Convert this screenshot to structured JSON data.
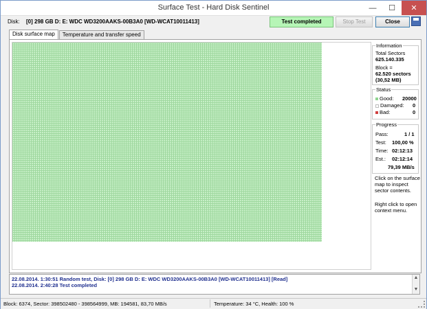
{
  "window": {
    "title": "Surface Test - Hard Disk Sentinel",
    "minimize": "—",
    "maximize": "☐",
    "close": "✕"
  },
  "disk": {
    "label": "Disk:",
    "value": "[0] 298 GB D: E: WDC WD3200AAKS-00B3A0 [WD-WCAT10011413]"
  },
  "toolbar": {
    "status": "Test completed",
    "stop_label": "Stop Test",
    "close_label": "Close",
    "save_icon": "save-icon"
  },
  "tabs": [
    {
      "label": "Disk surface map",
      "active": true
    },
    {
      "label": "Temperature and transfer speed",
      "active": false
    }
  ],
  "info": {
    "title": "Information",
    "total_sectors_label": "Total Sectors",
    "total_sectors_value": "625.140.335",
    "block_label": "Block =",
    "block_sectors": "62.520 sectors",
    "block_mb": "(30,52 MB)"
  },
  "status": {
    "title": "Status",
    "good_label": "Good:",
    "good_value": "20000",
    "damaged_label": "Damaged:",
    "damaged_value": "0",
    "bad_label": "Bad:",
    "bad_value": "0",
    "colors": {
      "good": "#8fd48f",
      "damaged": "#d8d8d8",
      "bad": "#d04040"
    }
  },
  "progress": {
    "title": "Progress",
    "pass_label": "Pass:",
    "pass_value": "1 / 1",
    "test_label": "Test:",
    "test_value": "100,00 %",
    "time_label": "Time:",
    "time_value": "02:12:13",
    "est_label": "Est.:",
    "est_value": "02:12:14",
    "speed": "79,39 MB/s"
  },
  "help": {
    "line1": "Click on the surface map to inspect sector contents.",
    "line2": "Right click to open context menu."
  },
  "log": [
    {
      "text": "22.08.2014.  1:30:51   Random test, Disk: [0] 298 GB D: E: WDC WD3200AAKS-00B3A0 [WD-WCAT10011413] [Read]"
    },
    {
      "text": "22.08.2014.  2:40:28   Test completed"
    }
  ],
  "statusbar": {
    "left": "Block: 6374, Sector: 398502480 - 398564999, MB: 194581, 83,70 MB/s",
    "right": "Temperature: 34  °C,  Health: 100 %"
  }
}
